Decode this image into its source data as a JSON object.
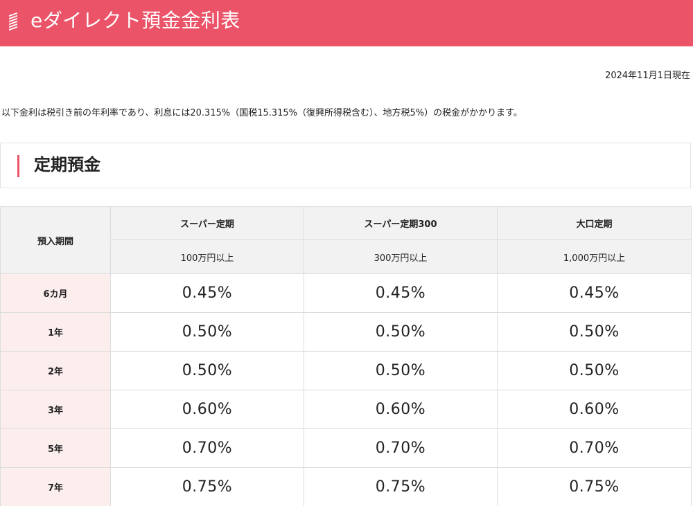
{
  "header": {
    "title": "eダイレクト預金金利表",
    "icon": "stripes-icon",
    "color": "#eb5468"
  },
  "as_of": "2024年11月1日現在",
  "notice": "以下金利は税引き前の年利率であり、利息には20.315%（国税15.315%（復興所得税含む）、地方税5%）の税金がかかります。",
  "section": {
    "title": "定期預金"
  },
  "table": {
    "period_header": "預入期間",
    "products": [
      {
        "name": "スーパー定期",
        "condition": "100万円以上"
      },
      {
        "name": "スーパー定期300",
        "condition": "300万円以上"
      },
      {
        "name": "大口定期",
        "condition": "1,000万円以上"
      }
    ],
    "rows": [
      {
        "period": "6カ月",
        "rates": [
          "0.45%",
          "0.45%",
          "0.45%"
        ]
      },
      {
        "period": "1年",
        "rates": [
          "0.50%",
          "0.50%",
          "0.50%"
        ]
      },
      {
        "period": "2年",
        "rates": [
          "0.50%",
          "0.50%",
          "0.50%"
        ]
      },
      {
        "period": "3年",
        "rates": [
          "0.60%",
          "0.60%",
          "0.60%"
        ]
      },
      {
        "period": "5年",
        "rates": [
          "0.70%",
          "0.70%",
          "0.70%"
        ]
      },
      {
        "period": "7年",
        "rates": [
          "0.75%",
          "0.75%",
          "0.75%"
        ]
      }
    ]
  }
}
